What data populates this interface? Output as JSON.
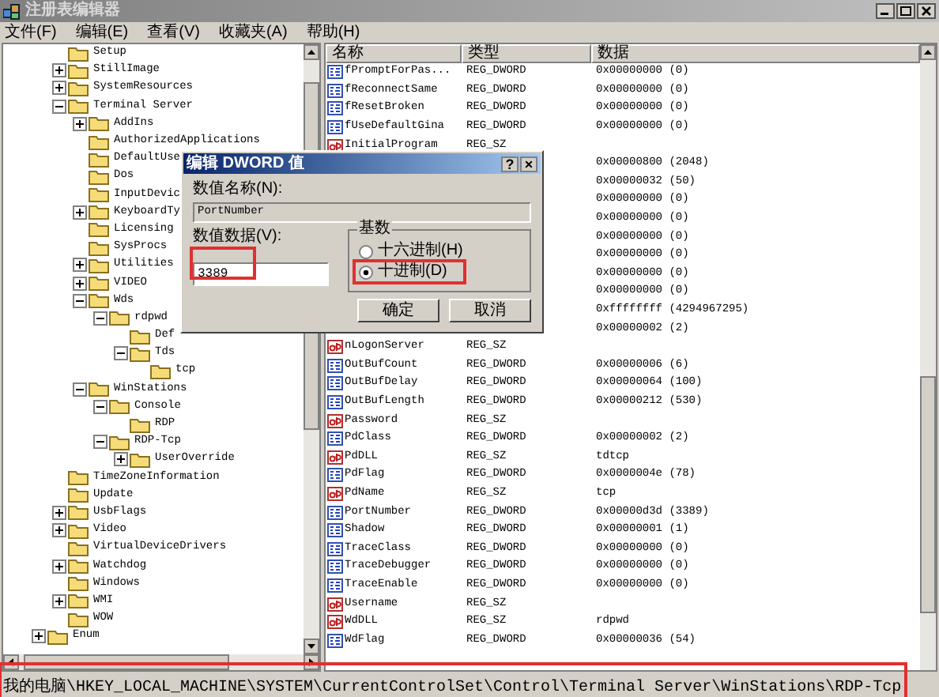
{
  "window": {
    "title": "注册表编辑器"
  },
  "menu": [
    "文件(F)",
    "编辑(E)",
    "查看(V)",
    "收藏夹(A)",
    "帮助(H)"
  ],
  "tree": {
    "items": [
      {
        "label": "Setup"
      },
      {
        "label": "StillImage",
        "expanded": false
      },
      {
        "label": "SystemResources",
        "expanded": false
      },
      {
        "label": "Terminal Server",
        "expanded": true,
        "children": [
          {
            "label": "AddIns",
            "expanded": false
          },
          {
            "label": "AuthorizedApplications"
          },
          {
            "label": "DefaultUse"
          },
          {
            "label": "Dos"
          },
          {
            "label": "InputDevic"
          },
          {
            "label": "KeyboardTy",
            "expanded": false
          },
          {
            "label": "Licensing"
          },
          {
            "label": "SysProcs"
          },
          {
            "label": "Utilities",
            "expanded": false
          },
          {
            "label": "VIDEO",
            "expanded": false
          },
          {
            "label": "Wds",
            "expanded": true,
            "children": [
              {
                "label": "rdpwd",
                "expanded": true,
                "children": [
                  {
                    "label": "Def"
                  },
                  {
                    "label": "Tds",
                    "expanded": true,
                    "children": [
                      {
                        "label": "tcp"
                      }
                    ]
                  }
                ]
              }
            ]
          },
          {
            "label": "WinStations",
            "expanded": true,
            "children": [
              {
                "label": "Console",
                "expanded": true,
                "children": [
                  {
                    "label": "RDP"
                  }
                ]
              },
              {
                "label": "RDP-Tcp",
                "expanded": true,
                "children": [
                  {
                    "label": "UserOverride",
                    "expanded": false
                  }
                ]
              }
            ]
          }
        ]
      },
      {
        "label": "TimeZoneInformation"
      },
      {
        "label": "Update"
      },
      {
        "label": "UsbFlags",
        "expanded": false
      },
      {
        "label": "Video",
        "expanded": false
      },
      {
        "label": "VirtualDeviceDrivers"
      },
      {
        "label": "Watchdog",
        "expanded": false
      },
      {
        "label": "Windows"
      },
      {
        "label": "WMI",
        "expanded": false
      },
      {
        "label": "WOW"
      }
    ],
    "outer_items": [
      {
        "label": "Enum",
        "expanded": false
      }
    ]
  },
  "list": {
    "columns": [
      "名称",
      "类型",
      "数据"
    ],
    "rows": [
      {
        "kind": "dword",
        "name": "fPromptForPas...",
        "type": "REG_DWORD",
        "data": "0x00000000 (0)"
      },
      {
        "kind": "dword",
        "name": "fReconnectSame",
        "type": "REG_DWORD",
        "data": "0x00000000 (0)"
      },
      {
        "kind": "dword",
        "name": "fResetBroken",
        "type": "REG_DWORD",
        "data": "0x00000000 (0)"
      },
      {
        "kind": "dword",
        "name": "fUseDefaultGina",
        "type": "REG_DWORD",
        "data": "0x00000000 (0)"
      },
      {
        "kind": "string",
        "name": "InitialProgram",
        "type": "REG_SZ"
      },
      {
        "data": "0x00000800 (2048)"
      },
      {
        "data": "0x00000032 (50)"
      },
      {
        "data": "0x00000000 (0)"
      },
      {
        "data": "0x00000000 (0)"
      },
      {
        "data": "0x00000000 (0)"
      },
      {
        "data": "0x00000000 (0)"
      },
      {
        "data": "0x00000000 (0)"
      },
      {
        "data": "0x00000000 (0)"
      },
      {
        "data": "0xffffffff (4294967295)"
      },
      {
        "data": "0x00000002 (2)"
      },
      {
        "kind": "string",
        "name": "nLogonServer",
        "type": "REG_SZ"
      },
      {
        "kind": "dword",
        "name": "OutBufCount",
        "type": "REG_DWORD",
        "data": "0x00000006 (6)"
      },
      {
        "kind": "dword",
        "name": "OutBufDelay",
        "type": "REG_DWORD",
        "data": "0x00000064 (100)"
      },
      {
        "kind": "dword",
        "name": "OutBufLength",
        "type": "REG_DWORD",
        "data": "0x00000212 (530)"
      },
      {
        "kind": "string",
        "name": "Password",
        "type": "REG_SZ"
      },
      {
        "kind": "dword",
        "name": "PdClass",
        "type": "REG_DWORD",
        "data": "0x00000002 (2)"
      },
      {
        "kind": "string",
        "name": "PdDLL",
        "type": "REG_SZ",
        "data": "tdtcp"
      },
      {
        "kind": "dword",
        "name": "PdFlag",
        "type": "REG_DWORD",
        "data": "0x0000004e (78)"
      },
      {
        "kind": "string",
        "name": "PdName",
        "type": "REG_SZ",
        "data": "tcp"
      },
      {
        "kind": "dword",
        "name": "PortNumber",
        "type": "REG_DWORD",
        "data": "0x00000d3d (3389)"
      },
      {
        "kind": "dword",
        "name": "Shadow",
        "type": "REG_DWORD",
        "data": "0x00000001 (1)"
      },
      {
        "kind": "dword",
        "name": "TraceClass",
        "type": "REG_DWORD",
        "data": "0x00000000 (0)"
      },
      {
        "kind": "dword",
        "name": "TraceDebugger",
        "type": "REG_DWORD",
        "data": "0x00000000 (0)"
      },
      {
        "kind": "dword",
        "name": "TraceEnable",
        "type": "REG_DWORD",
        "data": "0x00000000 (0)"
      },
      {
        "kind": "string",
        "name": "Username",
        "type": "REG_SZ"
      },
      {
        "kind": "string",
        "name": "WdDLL",
        "type": "REG_SZ",
        "data": "rdpwd"
      },
      {
        "kind": "dword",
        "name": "WdFlag",
        "type": "REG_DWORD",
        "data": "0x00000036 (54)"
      }
    ]
  },
  "dialog": {
    "title": "编辑 DWORD 值",
    "help_button": "?",
    "close_button": "×",
    "name_label": "数值名称(N):",
    "name_value": "PortNumber",
    "data_label": "数值数据(V):",
    "data_value": "3389",
    "base_group": "基数",
    "radios": [
      {
        "label": "十六进制(H)",
        "selected": false
      },
      {
        "label": "十进制(D)",
        "selected": true
      }
    ],
    "buttons": [
      "确定",
      "取消"
    ]
  },
  "status_bar": "我的电脑\\HKEY_LOCAL_MACHINE\\SYSTEM\\CurrentControlSet\\Control\\Terminal Server\\WinStations\\RDP-Tcp"
}
